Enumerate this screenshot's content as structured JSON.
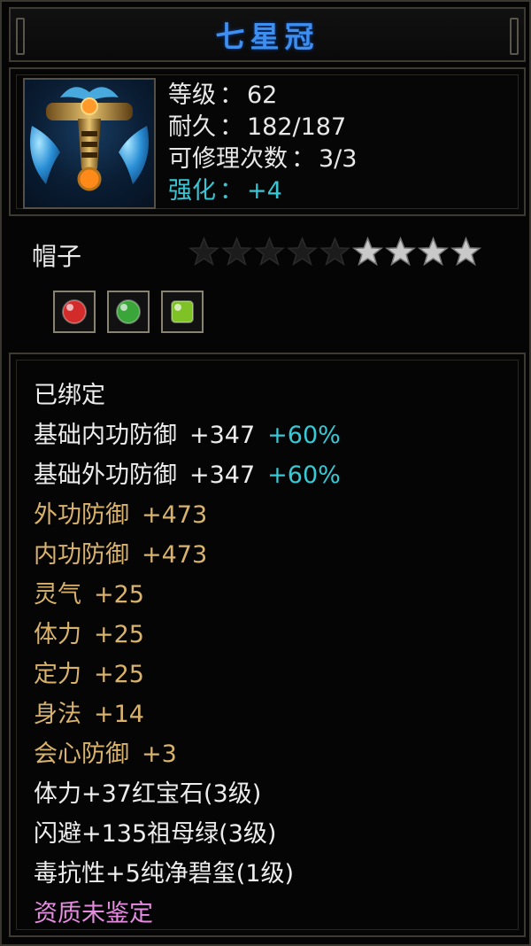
{
  "item": {
    "name": "七星冠",
    "level_label": "等级",
    "level_value": "62",
    "durability_label": "耐久",
    "durability_value": "182/187",
    "repair_label": "可修理次数",
    "repair_value": "3/3",
    "enhance_label": "强化",
    "enhance_value": "+4",
    "type": "帽子",
    "colon": "："
  },
  "stars": {
    "total": 9,
    "lit": 4
  },
  "gems": [
    {
      "name": "ruby-icon",
      "color": "#d32a2a"
    },
    {
      "name": "emerald-icon",
      "color": "#3aa63a"
    },
    {
      "name": "jade-icon",
      "color": "#7fc226"
    }
  ],
  "attributes": [
    {
      "text": "已绑定",
      "value": "",
      "pct": "",
      "color": "white"
    },
    {
      "text": "基础内功防御",
      "value": "+347",
      "pct": "+60%",
      "color": "white"
    },
    {
      "text": "基础外功防御",
      "value": "+347",
      "pct": "+60%",
      "color": "white"
    },
    {
      "text": "外功防御",
      "value": "+473",
      "pct": "",
      "color": "gold"
    },
    {
      "text": "内功防御",
      "value": "+473",
      "pct": "",
      "color": "gold"
    },
    {
      "text": "灵气",
      "value": "+25",
      "pct": "",
      "color": "gold"
    },
    {
      "text": "体力",
      "value": "+25",
      "pct": "",
      "color": "gold"
    },
    {
      "text": "定力",
      "value": "+25",
      "pct": "",
      "color": "gold"
    },
    {
      "text": "身法",
      "value": "+14",
      "pct": "",
      "color": "gold"
    },
    {
      "text": "会心防御",
      "value": "+3",
      "pct": "",
      "color": "gold"
    },
    {
      "text": "体力+37红宝石(3级)",
      "value": "",
      "pct": "",
      "color": "white"
    },
    {
      "text": "闪避+135祖母绿(3级)",
      "value": "",
      "pct": "",
      "color": "white"
    },
    {
      "text": "毒抗性+5纯净碧玺(1级)",
      "value": "",
      "pct": "",
      "color": "white"
    },
    {
      "text": "资质未鉴定",
      "value": "",
      "pct": "",
      "color": "pink"
    }
  ]
}
